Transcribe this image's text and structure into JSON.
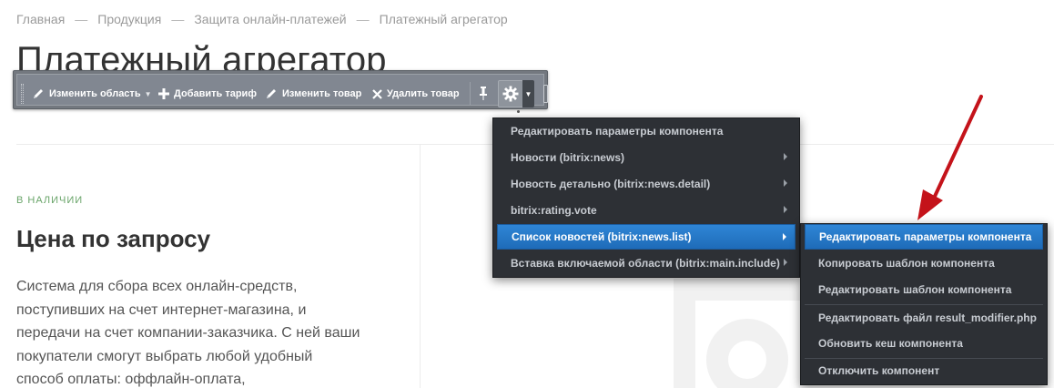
{
  "breadcrumb": {
    "items": [
      "Главная",
      "Продукция",
      "Защита онлайн-платежей",
      "Платежный агрегатор"
    ],
    "separator": "—"
  },
  "page": {
    "title": "Платежный агрегатор",
    "stock_status": "В НАЛИЧИИ",
    "price": "Цена по запросу",
    "description": "Система для сбора всех онлайн-средств, поступивших на счет интернет-магазина, и передачи на счет компании-заказчика. С ней ваши покупатели смогут выбрать любой удобный способ оплаты: оффлайн-оплата,"
  },
  "toolbar": {
    "edit_area": "Изменить область",
    "add_tariff": "Добавить тариф",
    "edit_product": "Изменить товар",
    "delete_product": "Удалить товар"
  },
  "component_menu": {
    "items": [
      {
        "label": "Редактировать параметры компонента",
        "submenu": false
      },
      {
        "label": "Новости (bitrix:news)",
        "submenu": true
      },
      {
        "label": "Новость детально (bitrix:news.detail)",
        "submenu": true
      },
      {
        "label": "bitrix:rating.vote",
        "submenu": true
      },
      {
        "label": "Список новостей (bitrix:news.list)",
        "submenu": true,
        "active": true
      },
      {
        "label": "Вставка включаемой области (bitrix:main.include)",
        "submenu": true
      }
    ]
  },
  "submenu": {
    "items": [
      {
        "label": "Редактировать параметры компонента",
        "active": true
      },
      {
        "label": "Копировать шаблон компонента"
      },
      {
        "label": "Редактировать шаблон компонента"
      },
      {
        "label": "Редактировать файл result_modifier.php"
      },
      {
        "label": "Обновить кеш компонента"
      },
      {
        "label": "Отключить компонент"
      }
    ]
  },
  "colors": {
    "accent_blue": "#2f86d6",
    "menu_bg": "#2d3035",
    "toolbar_bg": "#818791",
    "stock_green": "#6aa56a",
    "annotation_red": "#c4131a"
  }
}
